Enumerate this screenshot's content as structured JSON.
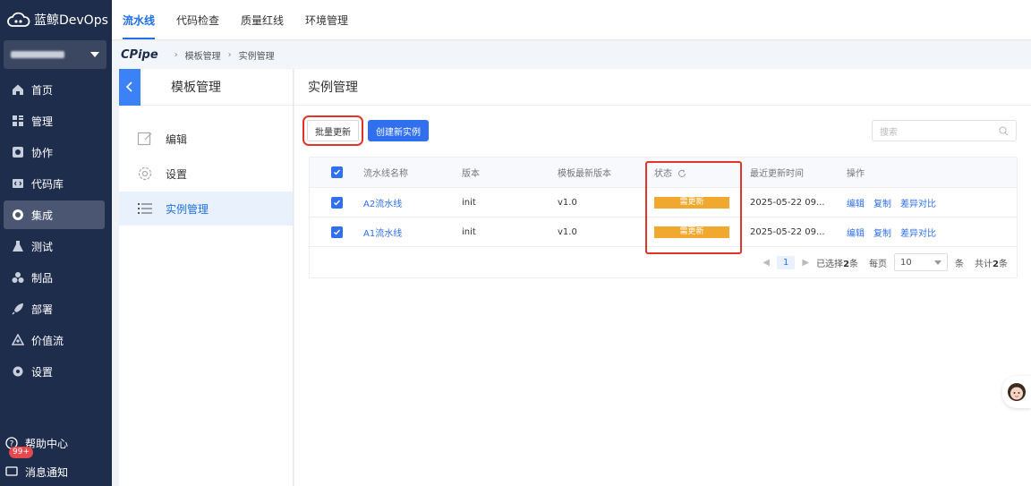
{
  "app": {
    "logo_text": "蓝鲸DevOps"
  },
  "nav": {
    "items": [
      {
        "label": "首页",
        "icon": "home-icon"
      },
      {
        "label": "管理",
        "icon": "grid-icon"
      },
      {
        "label": "协作",
        "icon": "collab-icon"
      },
      {
        "label": "代码库",
        "icon": "code-icon"
      },
      {
        "label": "集成",
        "icon": "integration-icon",
        "active": true
      },
      {
        "label": "测试",
        "icon": "flask-icon"
      },
      {
        "label": "制品",
        "icon": "artifact-icon"
      },
      {
        "label": "部署",
        "icon": "rocket-icon"
      },
      {
        "label": "价值流",
        "icon": "value-stream-icon"
      },
      {
        "label": "设置",
        "icon": "gear-icon"
      }
    ],
    "help_label": "帮助中心",
    "notify_label": "消息通知",
    "notify_badge": "99+"
  },
  "topbar": {
    "tabs": [
      "流水线",
      "代码检查",
      "质量红线",
      "环境管理"
    ]
  },
  "breadcrumb": {
    "brand": "CPipe",
    "items": [
      "模板管理",
      "实例管理"
    ]
  },
  "subpanel": {
    "title": "模板管理",
    "items": [
      "编辑",
      "设置",
      "实例管理"
    ]
  },
  "main": {
    "title": "实例管理",
    "batch_update_label": "批量更新",
    "create_label": "创建新实例",
    "search_placeholder": "搜索"
  },
  "table": {
    "headers": [
      "流水线名称",
      "版本",
      "模板最新版本",
      "状态",
      "最近更新时间",
      "操作"
    ],
    "rows": [
      {
        "name": "A2流水线",
        "version": "init",
        "tpl_version": "v1.0",
        "status": "需更新",
        "updated": "2025-05-22 09...",
        "ops": [
          "编辑",
          "复制",
          "差异对比"
        ]
      },
      {
        "name": "A1流水线",
        "version": "init",
        "tpl_version": "v1.0",
        "status": "需更新",
        "updated": "2025-05-22 09...",
        "ops": [
          "编辑",
          "复制",
          "差异对比"
        ]
      }
    ]
  },
  "pager": {
    "page": "1",
    "selected_prefix": "已选择",
    "selected_count": "2",
    "unit": "条",
    "per_page_label": "每页",
    "per_page": "10",
    "total_prefix": "共计",
    "total": "2"
  },
  "colors": {
    "primary": "#2f6ff0",
    "nav_bg": "#1f2d4d",
    "warning": "#f0a92e",
    "highlight": "#e0352b"
  }
}
